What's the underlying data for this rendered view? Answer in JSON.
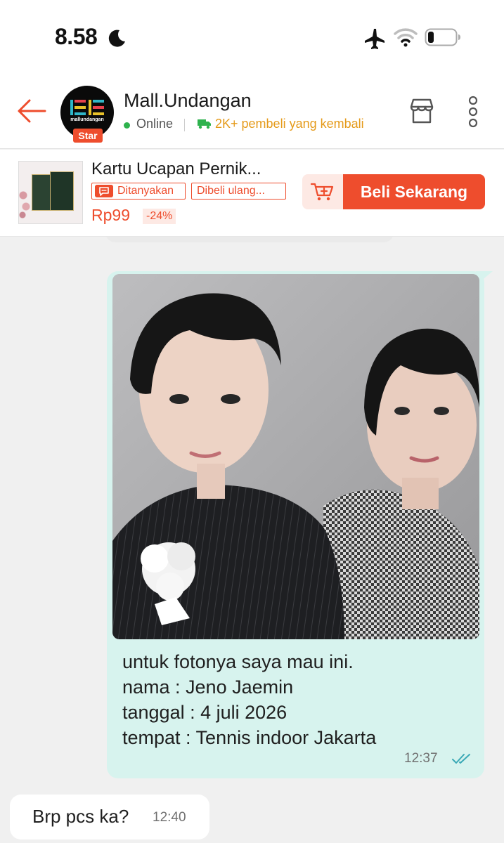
{
  "status_bar": {
    "time": "8.58",
    "icons": [
      "moon-icon",
      "airplane-icon",
      "wifi-icon",
      "battery-icon"
    ]
  },
  "header": {
    "shop_name": "Mall.Undangan",
    "avatar_text": "mallundangan",
    "badge": "Star",
    "status": "Online",
    "returning_buyers": "2K+ pembeli yang kembali",
    "icons": [
      "back-arrow-icon",
      "shop-icon",
      "more-vertical-icon"
    ]
  },
  "product": {
    "title": "Kartu Ucapan Pernik...",
    "tag_asked": "Ditanyakan",
    "tag_rebought": "Dibeli ulang...",
    "price": "Rp99",
    "discount": "-24%",
    "buy_label": "Beli Sekarang"
  },
  "messages": [
    {
      "direction": "sent",
      "has_photo": true,
      "lines": [
        "untuk fotonya saya mau ini.",
        "nama : Jeno Jaemin",
        "tanggal : 4 juli 2026",
        "tempat : Tennis indoor Jakarta"
      ],
      "time": "12:37",
      "read": true
    },
    {
      "direction": "received",
      "text": "Brp pcs ka?",
      "time": "12:40"
    }
  ],
  "colors": {
    "accent": "#ee4d2d",
    "sent_bubble": "#d7f3ee",
    "online": "#2eb24d",
    "returning": "#e59a1a",
    "read_ticks": "#3aa9b6"
  }
}
